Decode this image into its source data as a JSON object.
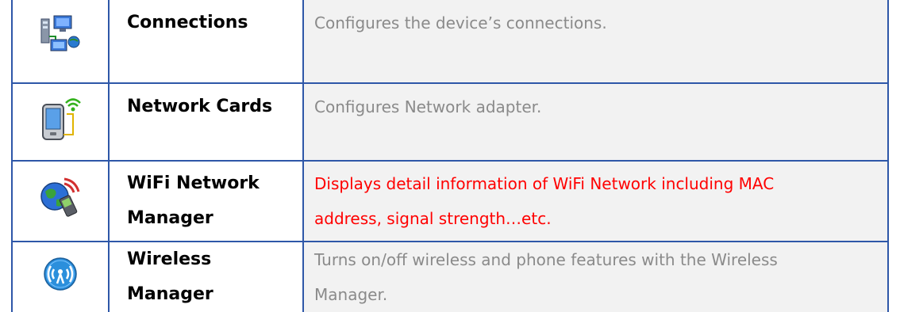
{
  "rows": [
    {
      "icon": "network-connections-icon",
      "name": "Connections",
      "description": "Configures the device’s connections."
    },
    {
      "icon": "network-card-icon",
      "name": "Network Cards",
      "description": "Configures Network adapter."
    },
    {
      "icon": "wifi-network-manager-icon",
      "name": "WiFi Network Manager",
      "name_lines": [
        "WiFi Network",
        "Manager"
      ],
      "description_lines": [
        "Displays detail information of WiFi Network including MAC",
        "address, signal strength…etc."
      ]
    },
    {
      "icon": "wireless-manager-icon",
      "name": "Wireless Manager",
      "name_lines": [
        "Wireless",
        "Manager"
      ],
      "description_lines": [
        "Turns on/off wireless and phone features with the Wireless",
        "Manager."
      ]
    }
  ],
  "colors": {
    "border": "#2e57a8",
    "description_text": "#8a8a8a",
    "highlight_text": "#ff0000",
    "description_bg": "#f2f2f2"
  }
}
